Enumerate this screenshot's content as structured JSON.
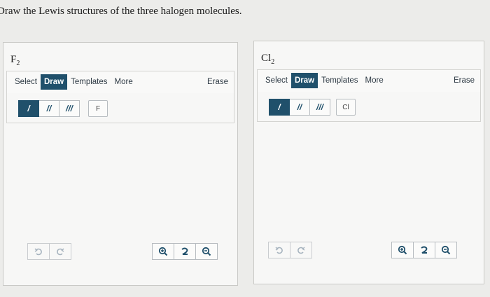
{
  "question": "Draw the Lewis structures of the three halogen molecules.",
  "panels": [
    {
      "formula_symbol": "F",
      "formula_subscript": "2",
      "tabs": [
        "Select",
        "Draw",
        "Templates",
        "More"
      ],
      "active_tab": "Draw",
      "erase_label": "Erase",
      "bond_labels": [
        "/",
        "//",
        "///"
      ],
      "atom_label": "F"
    },
    {
      "formula_symbol": "Cl",
      "formula_subscript": "2",
      "tabs": [
        "Select",
        "Draw",
        "Templates",
        "More"
      ],
      "active_tab": "Draw",
      "erase_label": "Erase",
      "bond_labels": [
        "/",
        "//",
        "///"
      ],
      "atom_label": "Cl"
    }
  ],
  "icons": {
    "undo": "undo-icon",
    "redo": "redo-icon",
    "zoom_in": "zoom-in-icon",
    "reset_zoom": "reset-zoom-icon",
    "zoom_out": "zoom-out-icon"
  },
  "colors": {
    "accent": "#20506b",
    "disabled_icon": "#9ba8b3"
  }
}
